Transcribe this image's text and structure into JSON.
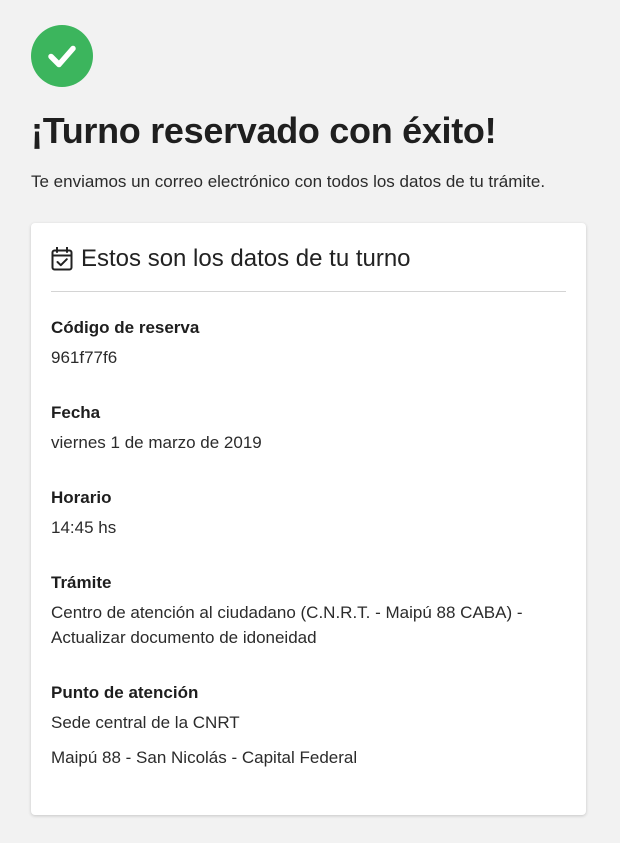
{
  "header": {
    "success_icon": "check-circle-icon",
    "title": "¡Turno reservado con éxito!",
    "subtitle": "Te enviamos un correo electrónico con todos los datos de tu trámite."
  },
  "card": {
    "icon": "calendar-check-icon",
    "title": "Estos son los datos de tu turno",
    "fields": [
      {
        "label": "Código de reserva",
        "value": "961f77f6"
      },
      {
        "label": "Fecha",
        "value": "viernes 1 de marzo de 2019"
      },
      {
        "label": "Horario",
        "value": "14:45 hs"
      },
      {
        "label": "Trámite",
        "value_line1": "Centro de atención al ciudadano (C.N.R.T. - Maipú 88 CABA) -",
        "value_line2": "Actualizar documento de idoneidad"
      },
      {
        "label": "Punto de atención",
        "value": "Sede central de la CNRT",
        "address": "Maipú 88 - San Nicolás - Capital Federal"
      }
    ]
  },
  "colors": {
    "success": "#3cb55d",
    "background": "#f2f2f2",
    "card": "#ffffff"
  }
}
